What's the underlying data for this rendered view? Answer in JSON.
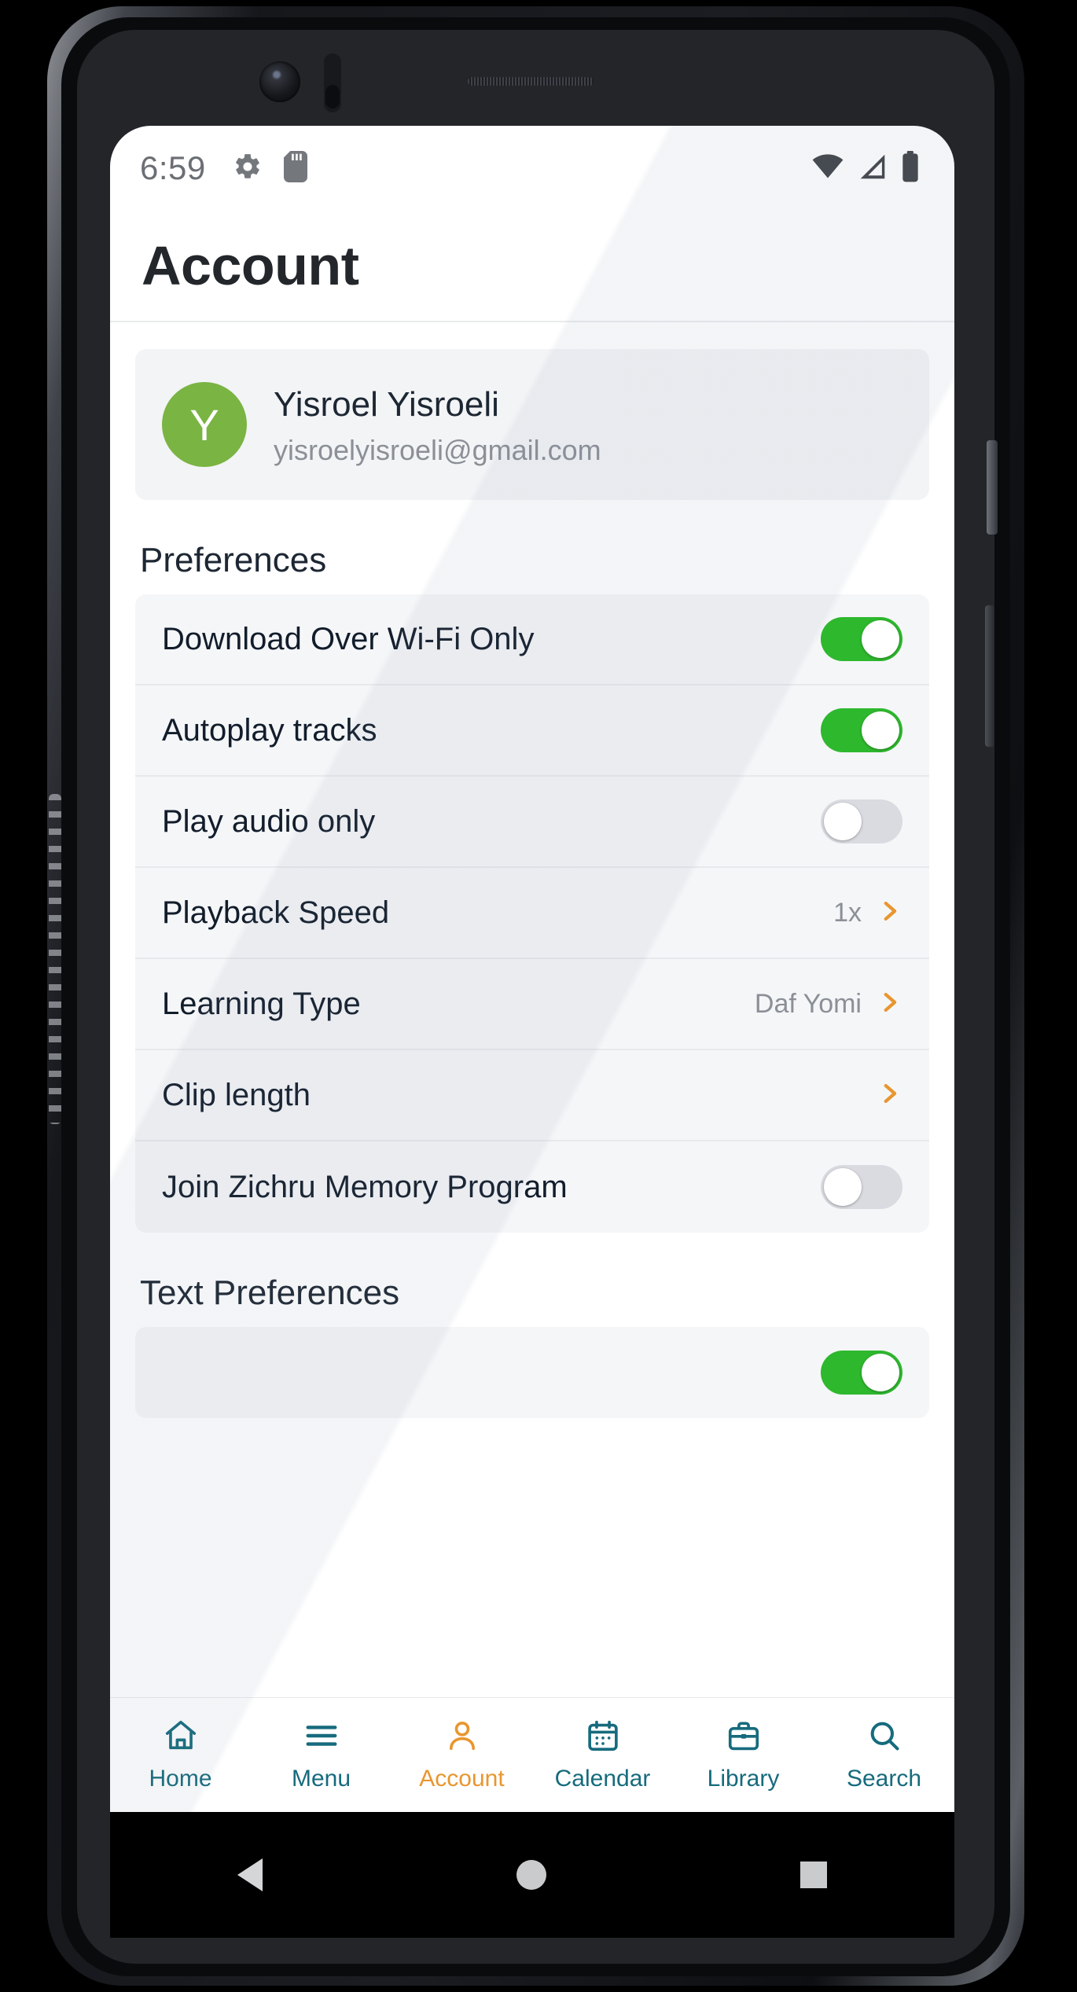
{
  "status_bar": {
    "time": "6:59",
    "left_icons": [
      "gear-icon",
      "sd-card-icon"
    ],
    "right_icons": [
      "wifi-icon",
      "cellular-signal-icon",
      "battery-icon"
    ]
  },
  "app_bar": {
    "title": "Account"
  },
  "profile": {
    "avatar_initial": "Y",
    "avatar_color": "#7ab443",
    "name": "Yisroel Yisroeli",
    "email": "yisroelyisroeli@gmail.com"
  },
  "sections": [
    {
      "title": "Preferences",
      "rows": [
        {
          "label": "Download Over Wi-Fi Only",
          "control": "toggle",
          "state": "on"
        },
        {
          "label": "Autoplay tracks",
          "control": "toggle",
          "state": "on"
        },
        {
          "label": "Play audio only",
          "control": "toggle",
          "state": "off"
        },
        {
          "label": "Playback Speed",
          "control": "chevron",
          "value": "1x"
        },
        {
          "label": "Learning Type",
          "control": "chevron",
          "value": "Daf Yomi"
        },
        {
          "label": "Clip length",
          "control": "chevron",
          "value": ""
        },
        {
          "label": "Join Zichru Memory Program",
          "control": "toggle",
          "state": "off"
        }
      ]
    },
    {
      "title": "Text Preferences",
      "rows": [
        {
          "label": "",
          "control": "toggle",
          "state": "on"
        }
      ]
    }
  ],
  "bottom_nav": {
    "active_color": "#e8962f",
    "inactive_color": "#166b7d",
    "items": [
      {
        "label": "Home",
        "icon": "home-icon",
        "active": false
      },
      {
        "label": "Menu",
        "icon": "hamburger-menu-icon",
        "active": false
      },
      {
        "label": "Account",
        "icon": "person-icon",
        "active": true
      },
      {
        "label": "Calendar",
        "icon": "calendar-icon",
        "active": false
      },
      {
        "label": "Library",
        "icon": "briefcase-icon",
        "active": false
      },
      {
        "label": "Search",
        "icon": "search-icon",
        "active": false
      }
    ]
  },
  "system_nav": {
    "back": "back-triangle-icon",
    "home": "home-circle-icon",
    "recents": "recents-square-icon"
  }
}
